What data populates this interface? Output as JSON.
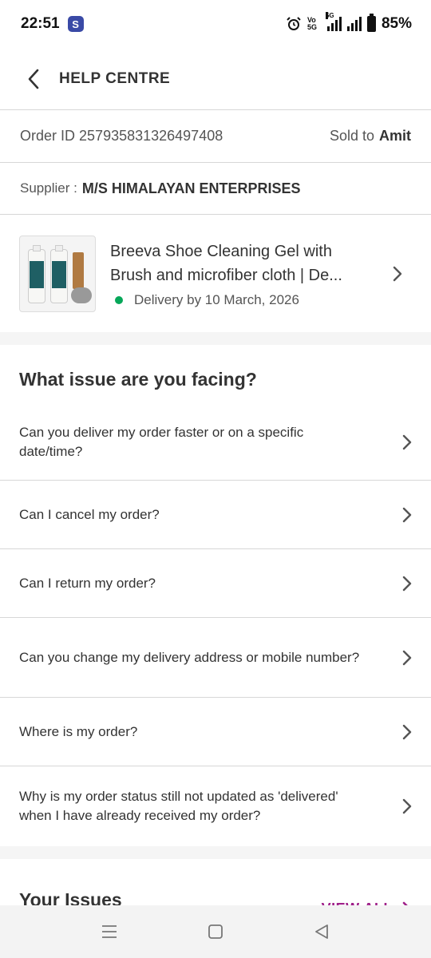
{
  "status_bar": {
    "time": "22:51",
    "app_icon": "S",
    "volte_label_top": "Vo",
    "volte_label_bottom": "5G",
    "network": "5G",
    "battery": "85%"
  },
  "header": {
    "title": "HELP CENTRE",
    "back_icon": "chevron-left-icon"
  },
  "order": {
    "order_id_label": "Order ID",
    "order_id": "257935831326497408",
    "sold_to_label": "Sold to",
    "sold_to_name": "Amit"
  },
  "supplier": {
    "label": "Supplier :",
    "name": "M/S HIMALAYAN ENTERPRISES"
  },
  "product": {
    "title": "Breeva Shoe Cleaning Gel with Brush and microfiber cloth | De...",
    "delivery": "Delivery by 10 March, 2026",
    "status_color": "#06a759"
  },
  "issues_section": {
    "title": "What issue are you facing?",
    "items": [
      {
        "label": "Can you deliver my order faster or on a specific date/time?"
      },
      {
        "label": "Can I cancel my order?"
      },
      {
        "label": "Can I return my order?"
      },
      {
        "label": "Can you change my delivery address or mobile number?"
      },
      {
        "label": "Where is my order?"
      },
      {
        "label": "Why is my order status still not updated as 'delivered' when I have already received my order?"
      }
    ]
  },
  "your_issues": {
    "title": "Your Issues",
    "view_all": "VIEW ALL",
    "accent_color": "#9f2089"
  },
  "nav": {
    "icons": [
      "menu-icon",
      "home-square-icon",
      "back-triangle-icon"
    ]
  }
}
